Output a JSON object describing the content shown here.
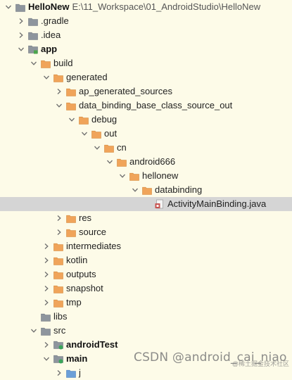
{
  "project": {
    "name": "HelloNew",
    "path": "E:\\11_Workspace\\01_AndroidStudio\\HelloNew"
  },
  "nodes": [
    {
      "label": "HelloNew",
      "indent": 0,
      "arrow": "down",
      "icon": "project-folder",
      "bold": true,
      "has_path": true
    },
    {
      "label": ".gradle",
      "indent": 1,
      "arrow": "right",
      "icon": "gray-folder"
    },
    {
      "label": ".idea",
      "indent": 1,
      "arrow": "right",
      "icon": "gray-folder"
    },
    {
      "label": "app",
      "indent": 1,
      "arrow": "down",
      "icon": "module-folder",
      "bold": true
    },
    {
      "label": "build",
      "indent": 2,
      "arrow": "down",
      "icon": "orange-folder"
    },
    {
      "label": "generated",
      "indent": 3,
      "arrow": "down",
      "icon": "orange-folder"
    },
    {
      "label": "ap_generated_sources",
      "indent": 4,
      "arrow": "right",
      "icon": "orange-folder"
    },
    {
      "label": "data_binding_base_class_source_out",
      "indent": 4,
      "arrow": "down",
      "icon": "orange-folder"
    },
    {
      "label": "debug",
      "indent": 5,
      "arrow": "down",
      "icon": "orange-folder"
    },
    {
      "label": "out",
      "indent": 6,
      "arrow": "down",
      "icon": "orange-folder"
    },
    {
      "label": "cn",
      "indent": 7,
      "arrow": "down",
      "icon": "orange-folder"
    },
    {
      "label": "android666",
      "indent": 8,
      "arrow": "down",
      "icon": "orange-folder"
    },
    {
      "label": "hellonew",
      "indent": 9,
      "arrow": "down",
      "icon": "orange-folder"
    },
    {
      "label": "databinding",
      "indent": 10,
      "arrow": "down",
      "icon": "orange-folder"
    },
    {
      "label": "ActivityMainBinding.java",
      "indent": 11,
      "arrow": "none",
      "icon": "java-file",
      "selected": true
    },
    {
      "label": "res",
      "indent": 4,
      "arrow": "right",
      "icon": "orange-folder"
    },
    {
      "label": "source",
      "indent": 4,
      "arrow": "right",
      "icon": "orange-folder"
    },
    {
      "label": "intermediates",
      "indent": 3,
      "arrow": "right",
      "icon": "orange-folder"
    },
    {
      "label": "kotlin",
      "indent": 3,
      "arrow": "right",
      "icon": "orange-folder"
    },
    {
      "label": "outputs",
      "indent": 3,
      "arrow": "right",
      "icon": "orange-folder"
    },
    {
      "label": "snapshot",
      "indent": 3,
      "arrow": "right",
      "icon": "orange-folder"
    },
    {
      "label": "tmp",
      "indent": 3,
      "arrow": "right",
      "icon": "orange-folder"
    },
    {
      "label": "libs",
      "indent": 2,
      "arrow": "none",
      "icon": "gray-folder"
    },
    {
      "label": "src",
      "indent": 2,
      "arrow": "down",
      "icon": "gray-folder"
    },
    {
      "label": "androidTest",
      "indent": 3,
      "arrow": "right",
      "icon": "source-folder",
      "bold": true
    },
    {
      "label": "main",
      "indent": 3,
      "arrow": "down",
      "icon": "source-folder",
      "bold": true
    },
    {
      "label": "j",
      "indent": 4,
      "arrow": "right",
      "icon": "blue-folder"
    }
  ],
  "watermark": "CSDN @android_cai_niao",
  "watermark_small": "@稀土掘金技术社区",
  "colors": {
    "background": "#fdfbe8",
    "selected": "#d5d5d5",
    "orange_folder": "#f0a45a",
    "gray_folder": "#8e959d",
    "blue_folder": "#6b9fd8",
    "java_file": "#c75450"
  }
}
